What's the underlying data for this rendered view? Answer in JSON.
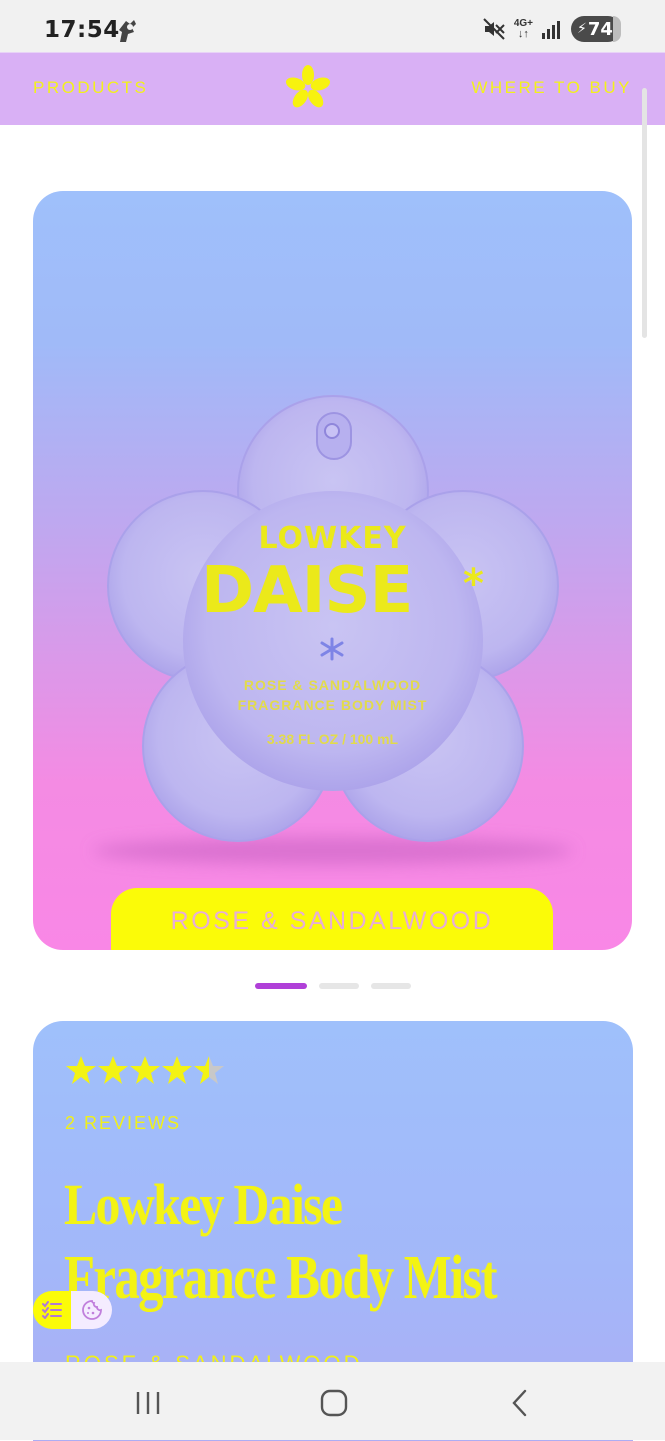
{
  "status_bar": {
    "time": "17:54",
    "network": "4G+",
    "battery_level": "74",
    "icons": [
      "app-notification-icon",
      "mute-vibrate-icon",
      "network-4g-icon",
      "signal-icon",
      "battery-charging-icon"
    ]
  },
  "header": {
    "nav_left": "PRODUCTS",
    "nav_right": "WHERE TO BUY",
    "logo_icon": "asterisk-flower-logo"
  },
  "hero": {
    "product_brand": "LOWKEY",
    "product_name": "DAISE",
    "product_asterisk": "*",
    "product_line1": "ROSE & SANDALWOOD",
    "product_line2": "FRAGRANCE BODY MIST",
    "product_volume": "3.38 FL OZ / 100 mL",
    "scent_label": "ROSE & SANDALWOOD"
  },
  "carousel": {
    "slide_count": 3,
    "active_index": 0
  },
  "info": {
    "rating": 4.5,
    "max_rating": 5,
    "reviews": "2 REVIEWS",
    "title": "Lowkey Daise",
    "subtitle": "Fragrance Body Mist",
    "scent": "ROSE & SANDALWOOD"
  },
  "widget": {
    "left_icon": "checklist-icon",
    "right_icon": "cookie-icon"
  },
  "navigation_bar": {
    "buttons": [
      "recent-apps",
      "home",
      "back"
    ]
  },
  "colors": {
    "header_bg": "#d9b0f5",
    "accent_yellow": "#f3f314",
    "active_dot": "#b040d8"
  }
}
